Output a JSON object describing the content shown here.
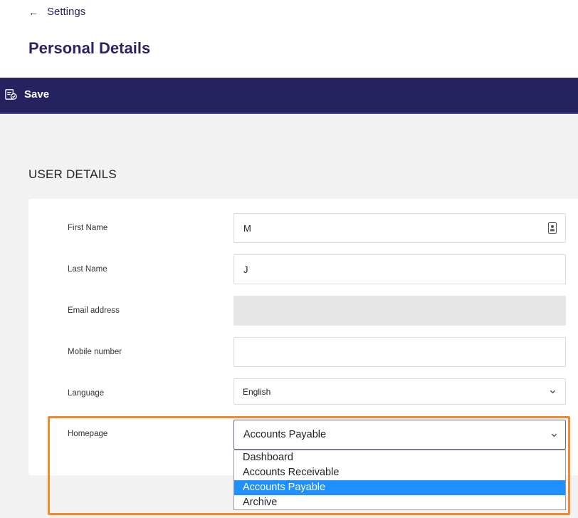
{
  "header": {
    "back_label": "Settings",
    "title": "Personal Details"
  },
  "toolbar": {
    "save_label": "Save"
  },
  "section": {
    "title": "USER DETAILS"
  },
  "form": {
    "first_name": {
      "label": "First Name",
      "value": "M"
    },
    "last_name": {
      "label": "Last Name",
      "value": "J"
    },
    "email": {
      "label": "Email address",
      "value": ""
    },
    "mobile": {
      "label": "Mobile number",
      "value": ""
    },
    "language": {
      "label": "Language",
      "value": "English"
    },
    "homepage": {
      "label": "Homepage",
      "value": "Accounts Payable",
      "options": [
        "Dashboard",
        "Accounts Receivable",
        "Accounts Payable",
        "Archive"
      ],
      "selected_index": 2
    }
  },
  "colors": {
    "primary": "#25225f",
    "title": "#2b2566",
    "highlight": "#f28a2a",
    "option_selected": "#1e90ff"
  }
}
